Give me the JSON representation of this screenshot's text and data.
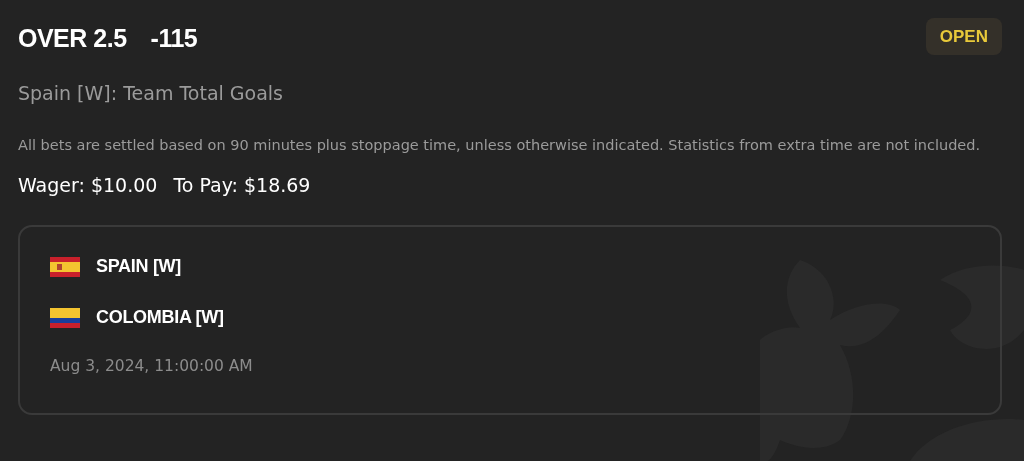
{
  "bet": {
    "selection": "OVER 2.5",
    "odds": "-115",
    "status": "OPEN",
    "market": "Spain [W]: Team Total Goals",
    "disclaimer": "All bets are settled based on 90 minutes plus stoppage time, unless otherwise indicated. Statistics from extra time are not included.",
    "wager": "Wager: $10.00",
    "to_pay": "To Pay: $18.69"
  },
  "event": {
    "teams": [
      {
        "name": "SPAIN [W]"
      },
      {
        "name": "COLOMBIA [W]"
      }
    ],
    "start_time": "Aug 3, 2024, 11:00:00 AM"
  }
}
